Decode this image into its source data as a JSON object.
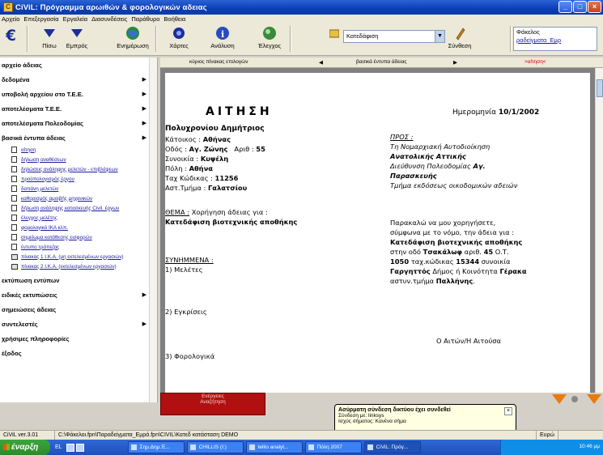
{
  "window": {
    "title": "CiViL: Πρόγραμμα αρωιθών & φορολογικών αδειας"
  },
  "menu": [
    "Αρχείο",
    "Επεξεργασία",
    "Εργαλεία",
    "Διασυνδέσεις",
    "Παράθυρο",
    "Βοήθεια"
  ],
  "toolbar": {
    "back": "Πίσω",
    "forward": "Εμπρός",
    "update": "Ενημέρωση",
    "maps": "Χάρτες",
    "analysis": "Ανάλυση",
    "check": "Έλεγχος",
    "type_value": "Κατεδάφιση",
    "connection": "Σύνθεση",
    "folder_label": "Φάκελος",
    "folder_value": "ραδείγματα_Εμρ"
  },
  "sidebar": {
    "items": [
      {
        "label": "αρχείο άδειας",
        "arrow": false
      },
      {
        "label": "δεδομένα",
        "arrow": true
      },
      {
        "label": "υποβολή αρχείου στο Τ.Ε.Ε.",
        "arrow": true
      },
      {
        "label": "αποτελέσματα Τ.Ε.Ε.",
        "arrow": true
      },
      {
        "label": "αποτελέσματα Πολεοδομίας",
        "arrow": true
      },
      {
        "label": "βασικά έντυπα άδειας",
        "arrow": true
      }
    ],
    "subitems": [
      {
        "label": "αίτηση",
        "icon": "doc"
      },
      {
        "label": "δήλωση αναθέσεων",
        "icon": "doc"
      },
      {
        "label": "δηλώσεις ανάληψης μελετών - επιβλέψεων",
        "icon": "doc"
      },
      {
        "label": "προϋπολογισμός έργου",
        "icon": "doc"
      },
      {
        "label": "δαπάνη μελετών",
        "icon": "doc"
      },
      {
        "label": "καθορισμός αμοιβής μηχανικών",
        "icon": "doc"
      },
      {
        "label": "δήλωση ανάληψης κατασκευής Civil. έργων",
        "icon": "doc"
      },
      {
        "label": "έλεγχος μελέτης",
        "icon": "doc"
      },
      {
        "label": "φορολογικό ΙΚΑ κλπ.",
        "icon": "doc"
      },
      {
        "label": "σημείωμα κατάθεσης εισφορών",
        "icon": "doc"
      },
      {
        "label": "έντυπο τράπεζας",
        "icon": "doc"
      },
      {
        "label": "πίνακας 1 Ι.Κ.Α. (μη εκτελεσμένων εργασιών)",
        "icon": "table"
      },
      {
        "label": "πίνακας 2 Ι.Κ.Α. (εκτελεσμένων εργασιών)",
        "icon": "table"
      }
    ],
    "items_after": [
      {
        "label": "εκτύπωση εντύπων",
        "arrow": false
      },
      {
        "label": "ειδικές εκτυπώσεις",
        "arrow": true
      },
      {
        "label": "σημειώσεις άδειας",
        "arrow": false
      },
      {
        "label": "συντελεστές",
        "arrow": true
      },
      {
        "label": "χρήσιμες πληροφορίες",
        "arrow": false
      },
      {
        "label": "έξοδος",
        "arrow": false
      }
    ]
  },
  "tabs": {
    "left": "κύριος πίνακας επιλογών",
    "middle": "βασικά έντυπα άδειας",
    "right": ">αίτηση<"
  },
  "document": {
    "heading": "ΑΙΤΗΣΗ",
    "date_label": "Ημερομηνία",
    "date_value": "10/1/2002",
    "name": "Πολυχρονίου Δημήτριος",
    "resident_label": "Κάτοικος :",
    "resident_value": "Αθήνας",
    "street_label": "Οδός :",
    "street_value": "Αγ. Ζώνης",
    "number_label": "Αριθ :",
    "number_value": "55",
    "district_label": "Συνοικία :",
    "district_value": "Κυψέλη",
    "city_label": "Πόλη :",
    "city_value": "Αθήνα",
    "zip_label": "Ταχ Κώδικας :",
    "zip_value": "11256",
    "police_label": "Αστ.Τμήμα :",
    "police_value": "Γαλατσίου",
    "to_label": "ΠΡΟΣ :",
    "to_line1": "Τη Νομαρχιακή Αυτοδιοίκηση",
    "to_line2": "Ανατολικής Αττικής",
    "to_line3": "Διεύθυνση Πολεοδομίας",
    "to_line3b": "Αγ.",
    "to_line4": "Παρασκευής",
    "to_line5": "Τμήμα εκδόσεως οικοδομικών αδειών",
    "subject_label": "ΘΕΜΑ :",
    "subject_text": "Χορήγηση άδειας για :",
    "subject_value": "Κατεδάφιση βιοτεχνικής αποθήκης",
    "request_line1": "Παρακαλώ να μου χορηγήσετε,",
    "request_line2": "σύμφωνα με το νόμο, την άδεια για :",
    "request_line3": "Κατεδάφιση βιοτεχνικής αποθήκης",
    "request_line4a": "στην οδό",
    "request_line4b": "Τσακάλωφ",
    "request_line4c": "αριθ.",
    "request_line4d": "45",
    "request_line4e": "Ο.Τ.",
    "request_line5a": "1050",
    "request_line5b": "ταχ.κώδικας",
    "request_line5c": "15344",
    "request_line5d": "συνοικία",
    "request_line6a": "Γαργηττός",
    "request_line6b": "Δήμος ή Κοινότητα",
    "request_line6c": "Γέρακα",
    "request_line7a": "αστυν.τμήμα",
    "request_line7b": "Παλλήνης",
    "attachments_label": "ΣΥΝΗΜΜΕΝΑ :",
    "attachment1": "1) Μελέτες",
    "attachment2": "2) Εγκρίσεις",
    "attachment3": "3) Φορολογικά",
    "signature": "Ο Αιτών/Η Αιτούσα"
  },
  "bottom": {
    "red_label1": "Ενέργειες",
    "red_label2": "Αναζήτηση"
  },
  "balloon": {
    "title": "Ασύρματη σύνδεση δικτύου έχει συνδεθεί",
    "line1": "Σύνδεση με: linksys",
    "line2": "Ισχύς σήματος: Κανένα σήμα"
  },
  "status": {
    "version": "CiViL ver.3.01",
    "path": "C:\\Φάκελοι.fpn\\Παραδείγματα_Εμρά.fpn\\CIVIL\\Κατεδ κατάσταση DEMO",
    "right": "Ευρώ"
  },
  "taskbar": {
    "start": "έναρξη",
    "lang": "EL",
    "tasks": [
      "Σημ.Δημ.Έ...",
      "CHILLIS (I:)",
      "tellio analyt...",
      "Πόλη 2007",
      "CiViL: Πρόγ..."
    ],
    "clock": "10:46 μμ"
  }
}
